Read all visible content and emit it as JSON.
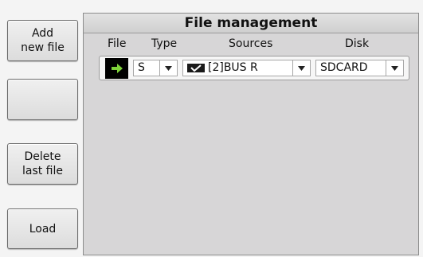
{
  "side_buttons": {
    "add": "Add\nnew file",
    "blank": "",
    "delete": "Delete\nlast file",
    "load": "Load"
  },
  "panel": {
    "title": "File management",
    "headers": {
      "file": "File",
      "type": "Type",
      "sources": "Sources",
      "disk": "Disk"
    },
    "row": {
      "file_icon": "arrow-right-icon",
      "type": "S",
      "source_checked": true,
      "source": "[2]BUS R",
      "disk": "SDCARD"
    }
  },
  "colors": {
    "arrow": "#7fd33a",
    "panel_bg": "#d7d6d7"
  }
}
